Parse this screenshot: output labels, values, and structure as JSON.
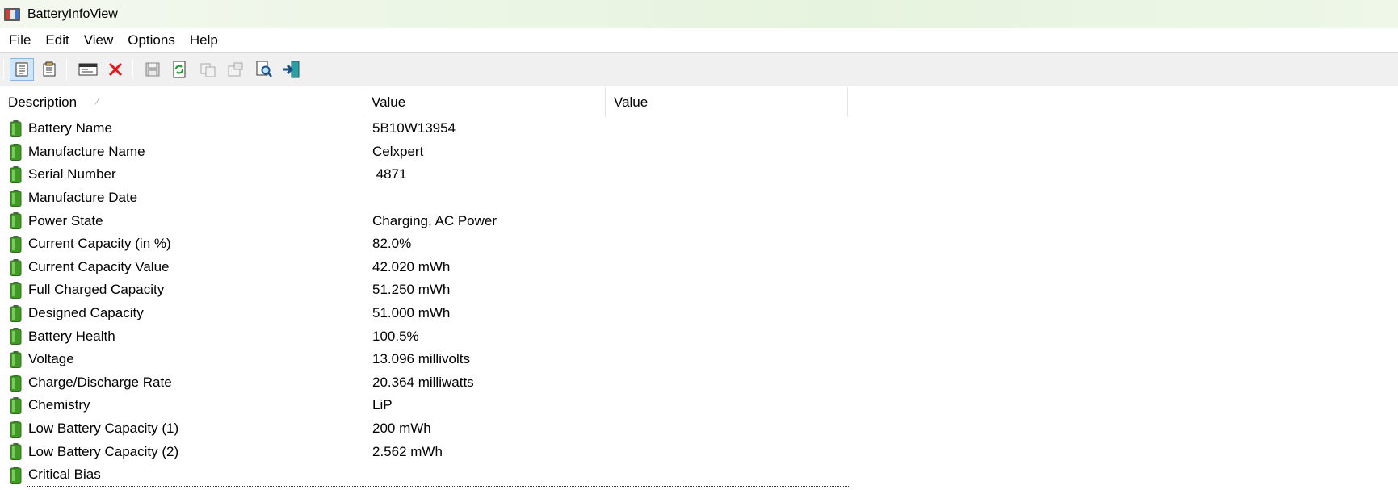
{
  "window": {
    "title": "BatteryInfoView"
  },
  "menu": [
    "File",
    "Edit",
    "View",
    "Options",
    "Help"
  ],
  "toolbar": {
    "buttons": [
      "properties-icon",
      "html-report-icon",
      "html-view-icon",
      "delete-icon",
      "save-icon",
      "refresh-icon",
      "copy-icon",
      "properties-disabled-icon",
      "find-icon",
      "exit-icon"
    ]
  },
  "columns": [
    "Description",
    "Value",
    "Value"
  ],
  "rows": [
    {
      "description": "Battery Name",
      "value": "5B10W13954"
    },
    {
      "description": "Manufacture Name",
      "value": "Celxpert"
    },
    {
      "description": "Serial Number",
      "value": " 4871"
    },
    {
      "description": "Manufacture Date",
      "value": ""
    },
    {
      "description": "Power State",
      "value": "Charging, AC Power"
    },
    {
      "description": "Current Capacity (in %)",
      "value": "82.0%"
    },
    {
      "description": "Current Capacity Value",
      "value": "42.020 mWh"
    },
    {
      "description": "Full Charged Capacity",
      "value": "51.250 mWh"
    },
    {
      "description": "Designed Capacity",
      "value": "51.000 mWh"
    },
    {
      "description": "Battery Health",
      "value": "100.5%"
    },
    {
      "description": "Voltage",
      "value": "13.096 millivolts"
    },
    {
      "description": "Charge/Discharge Rate",
      "value": "20.364 milliwatts"
    },
    {
      "description": "Chemistry",
      "value": "LiP"
    },
    {
      "description": "Low Battery Capacity (1)",
      "value": "200 mWh"
    },
    {
      "description": "Low Battery Capacity (2)",
      "value": "2.562 mWh"
    },
    {
      "description": "Critical Bias",
      "value": ""
    }
  ],
  "colors": {
    "battery_green": "#3f9a24",
    "title_bg": "#eaf5e3",
    "toolbar_bg": "#f0f0f0"
  }
}
